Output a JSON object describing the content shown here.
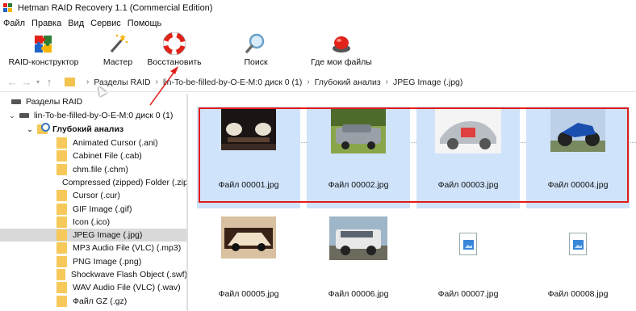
{
  "window": {
    "title": "Hetman RAID Recovery 1.1 (Commercial Edition)"
  },
  "menu": [
    "Файл",
    "Правка",
    "Вид",
    "Сервис",
    "Помощь"
  ],
  "toolbar": {
    "raid_constructor": "RAID-конструктор",
    "wizard": "Мастер",
    "restore": "Восстановить",
    "search": "Поиск",
    "where_files": "Где мои файлы"
  },
  "address": {
    "crumbs": [
      "Разделы RAID",
      "lin-To-be-filled-by-O-E-M:0 диск 0 (1)",
      "Глубокий анализ",
      "JPEG Image (.jpg)"
    ]
  },
  "tree": {
    "root": "Разделы RAID",
    "disk": "lin-To-be-filled-by-O-E-M:0 диск 0 (1)",
    "deep": "Глубокий анализ",
    "items": [
      "Animated Cursor (.ani)",
      "Cabinet File (.cab)",
      "chm.file (.chm)",
      "Compressed (zipped) Folder (.zip)",
      "Cursor (.cur)",
      "GIF Image (.gif)",
      "Icon (.ico)",
      "JPEG Image (.jpg)",
      "MP3 Audio File (VLC) (.mp3)",
      "PNG Image (.png)",
      "Shockwave Flash Object (.swf)",
      "WAV Audio File (VLC) (.wav)",
      "Файл GZ (.gz)"
    ],
    "selected_index": 7
  },
  "files": [
    {
      "name": "Файл 00001.jpg",
      "selected": true
    },
    {
      "name": "Файл 00002.jpg",
      "selected": true
    },
    {
      "name": "Файл 00003.jpg",
      "selected": true
    },
    {
      "name": "Файл 00004.jpg",
      "selected": true
    },
    {
      "name": "Файл 00005.jpg",
      "selected": false
    },
    {
      "name": "Файл 00006.jpg",
      "selected": false
    },
    {
      "name": "Файл 00007.jpg",
      "selected": false
    },
    {
      "name": "Файл 00008.jpg",
      "selected": false
    }
  ],
  "colors": {
    "highlight": "#e31b1b",
    "selection": "#cfe3fb",
    "folder": "#f6c95a"
  }
}
